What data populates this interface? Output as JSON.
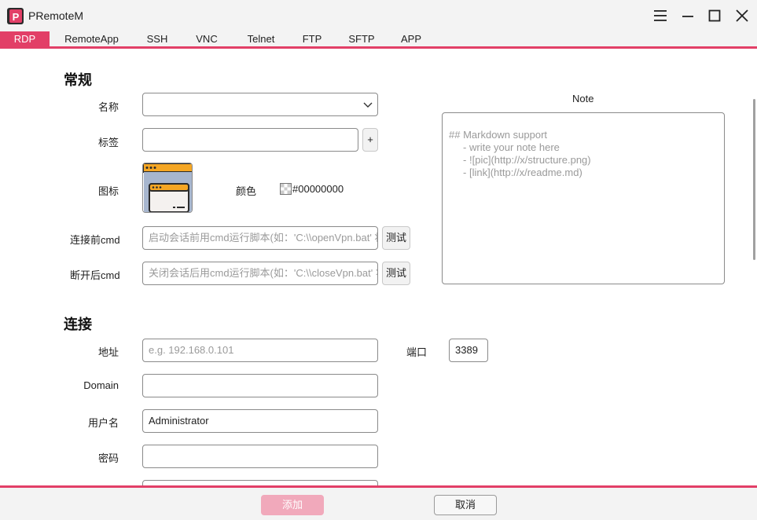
{
  "app": {
    "title": "PRemoteM"
  },
  "tabs": [
    {
      "label": "RDP",
      "active": true
    },
    {
      "label": "RemoteApp"
    },
    {
      "label": "SSH"
    },
    {
      "label": "VNC"
    },
    {
      "label": "Telnet"
    },
    {
      "label": "FTP"
    },
    {
      "label": "SFTP"
    },
    {
      "label": "APP"
    }
  ],
  "general": {
    "section_title": "常规",
    "name_label": "名称",
    "name_value": "",
    "tags_label": "标签",
    "tags_value": "",
    "add_tag_label": "+",
    "icon_label": "图标",
    "color_label": "颜色",
    "color_value": "#00000000",
    "pre_cmd_label": "连接前cmd",
    "pre_cmd_placeholder": "启动会话前用cmd运行脚本(如：'C:\\\\openVpn.bat' 将",
    "pre_cmd_test": "测试",
    "post_cmd_label": "断开后cmd",
    "post_cmd_placeholder": "关闭会话后用cmd运行脚本(如：'C:\\\\closeVpn.bat' 将",
    "post_cmd_test": "测试"
  },
  "note": {
    "label": "Note",
    "lines": [
      "## Markdown support",
      "     - write your note here",
      "     - ![pic](http://x/structure.png)",
      "     - [link](http://x/readme.md)"
    ]
  },
  "connection": {
    "section_title": "连接",
    "address_label": "地址",
    "address_placeholder": "e.g. 192.168.0.101",
    "port_label": "端口",
    "port_value": "3389",
    "domain_label": "Domain",
    "domain_value": "",
    "username_label": "用户名",
    "username_value": "Administrator",
    "password_label": "密码",
    "password_value": ""
  },
  "footer": {
    "add_label": "添加",
    "cancel_label": "取消"
  },
  "colors": {
    "accent": "#e23f67",
    "add_disabled": "#f1a9bb"
  }
}
